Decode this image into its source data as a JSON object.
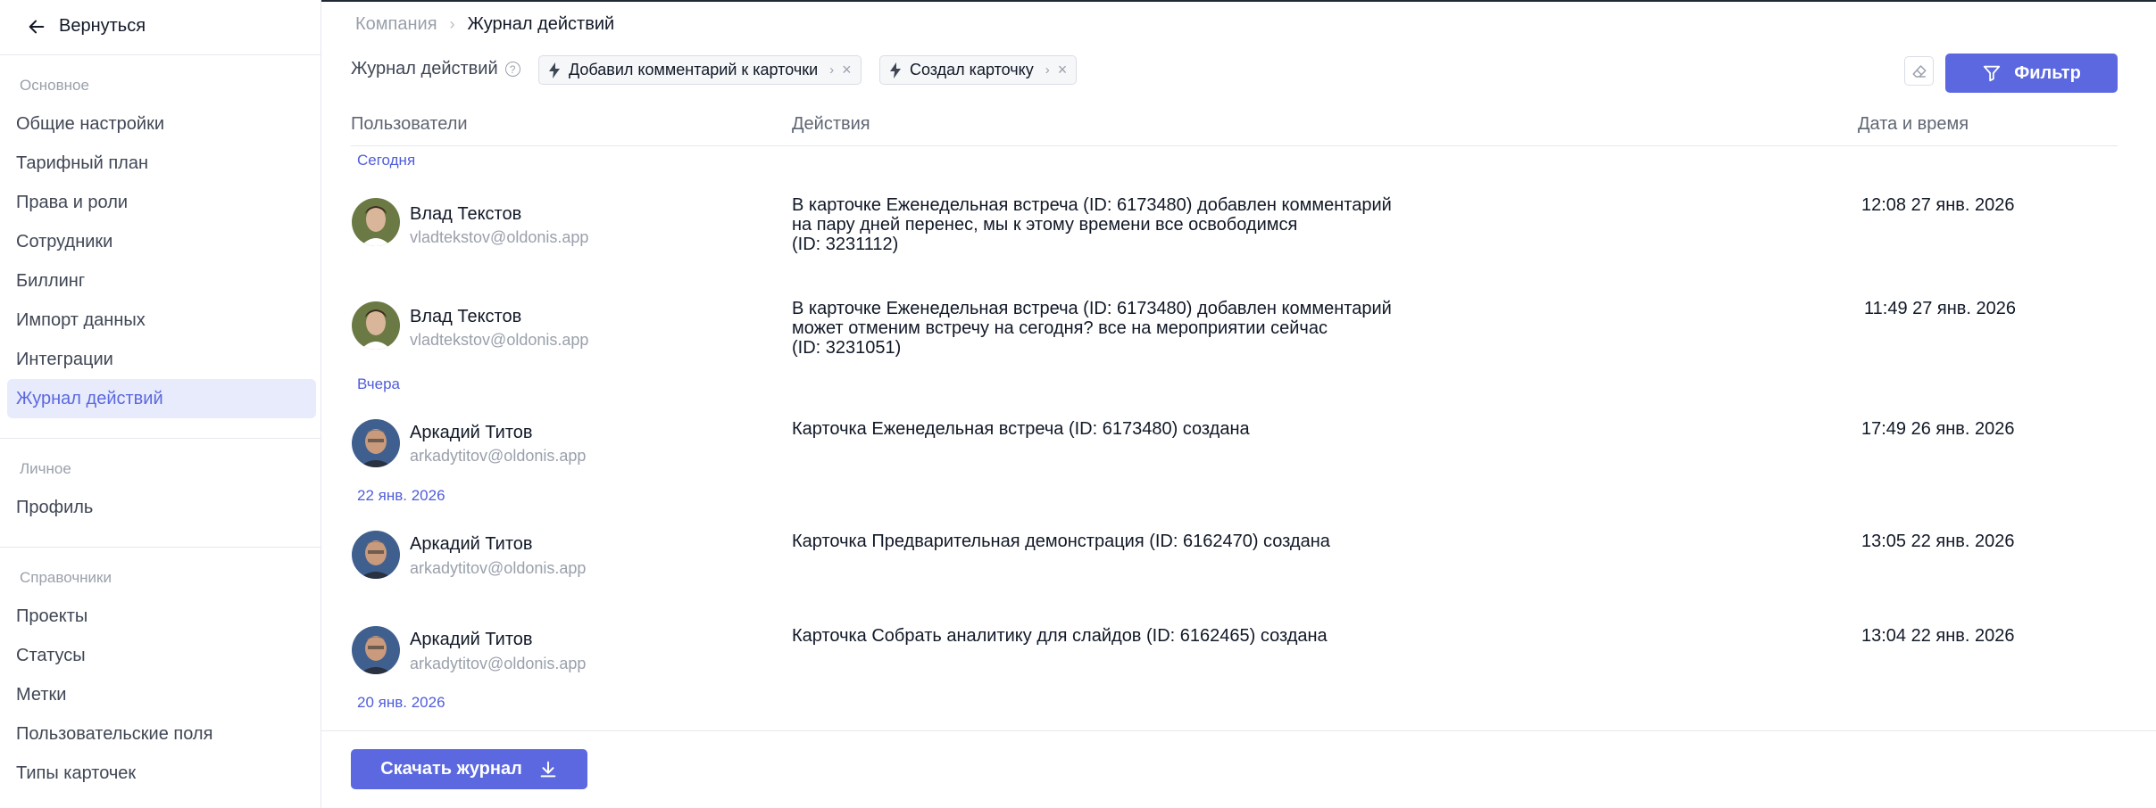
{
  "sidebar": {
    "back_label": "Вернуться",
    "section_main": "Основное",
    "main_items": [
      "Общие настройки",
      "Тарифный план",
      "Права и роли",
      "Сотрудники",
      "Биллинг",
      "Импорт данных",
      "Интеграции",
      "Журнал действий"
    ],
    "active_item": "Журнал действий",
    "section_personal": "Личное",
    "personal_items": [
      "Профиль"
    ],
    "section_refs": "Справочники",
    "ref_items": [
      "Проекты",
      "Статусы",
      "Метки",
      "Пользовательские поля",
      "Типы карточек"
    ]
  },
  "breadcrumb": {
    "parent": "Компания",
    "current": "Журнал действий"
  },
  "toolbar": {
    "label": "Журнал действий",
    "chips": [
      "Добавил комментарий к карточки",
      "Создал карточку"
    ],
    "filter_label": "Фильтр",
    "icons": {
      "chip": "bolt-icon",
      "clear": "eraser-icon",
      "filter": "funnel-icon"
    }
  },
  "table": {
    "headers": {
      "users": "Пользователи",
      "actions": "Действия",
      "datetime": "Дата и время"
    },
    "groups": {
      "today": "Сегодня",
      "yesterday": "Вчера",
      "jan22": "22 янв. 2026",
      "jan20": "20 янв. 2026"
    },
    "rows": [
      {
        "name": "Влад Текстов",
        "email": "vladtekstov@oldonis.app",
        "action": "В карточке Еженедельная встреча (ID: 6173480) добавлен комментарий\nна пару дней перенес, мы к этому времени все освободимся\n(ID: 3231112)",
        "datetime": "12:08 27 янв. 2026"
      },
      {
        "name": "Влад Текстов",
        "email": "vladtekstov@oldonis.app",
        "action": "В карточке Еженедельная встреча (ID: 6173480) добавлен комментарий\nможет отменим встречу на сегодня? все на мероприятии сейчас\n(ID: 3231051)",
        "datetime": "11:49 27 янв. 2026"
      },
      {
        "name": "Аркадий Титов",
        "email": "arkadytitov@oldonis.app",
        "action": "Карточка Еженедельная встреча (ID: 6173480) создана",
        "datetime": "17:49 26 янв. 2026"
      },
      {
        "name": "Аркадий Титов",
        "email": "arkadytitov@oldonis.app",
        "action": "Карточка Предварительная демонстрация (ID: 6162470) создана",
        "datetime": "13:05 22 янв. 2026"
      },
      {
        "name": "Аркадий Титов",
        "email": "arkadytitov@oldonis.app",
        "action": "Карточка Собрать аналитику для слайдов (ID: 6162465) создана",
        "datetime": "13:04 22 янв. 2026"
      }
    ]
  },
  "download": {
    "label": "Скачать журнал",
    "icon": "download-icon"
  },
  "colors": {
    "accent": "#5b68e0",
    "active_bg": "#e8ebfb",
    "muted": "#9aa0ab"
  }
}
